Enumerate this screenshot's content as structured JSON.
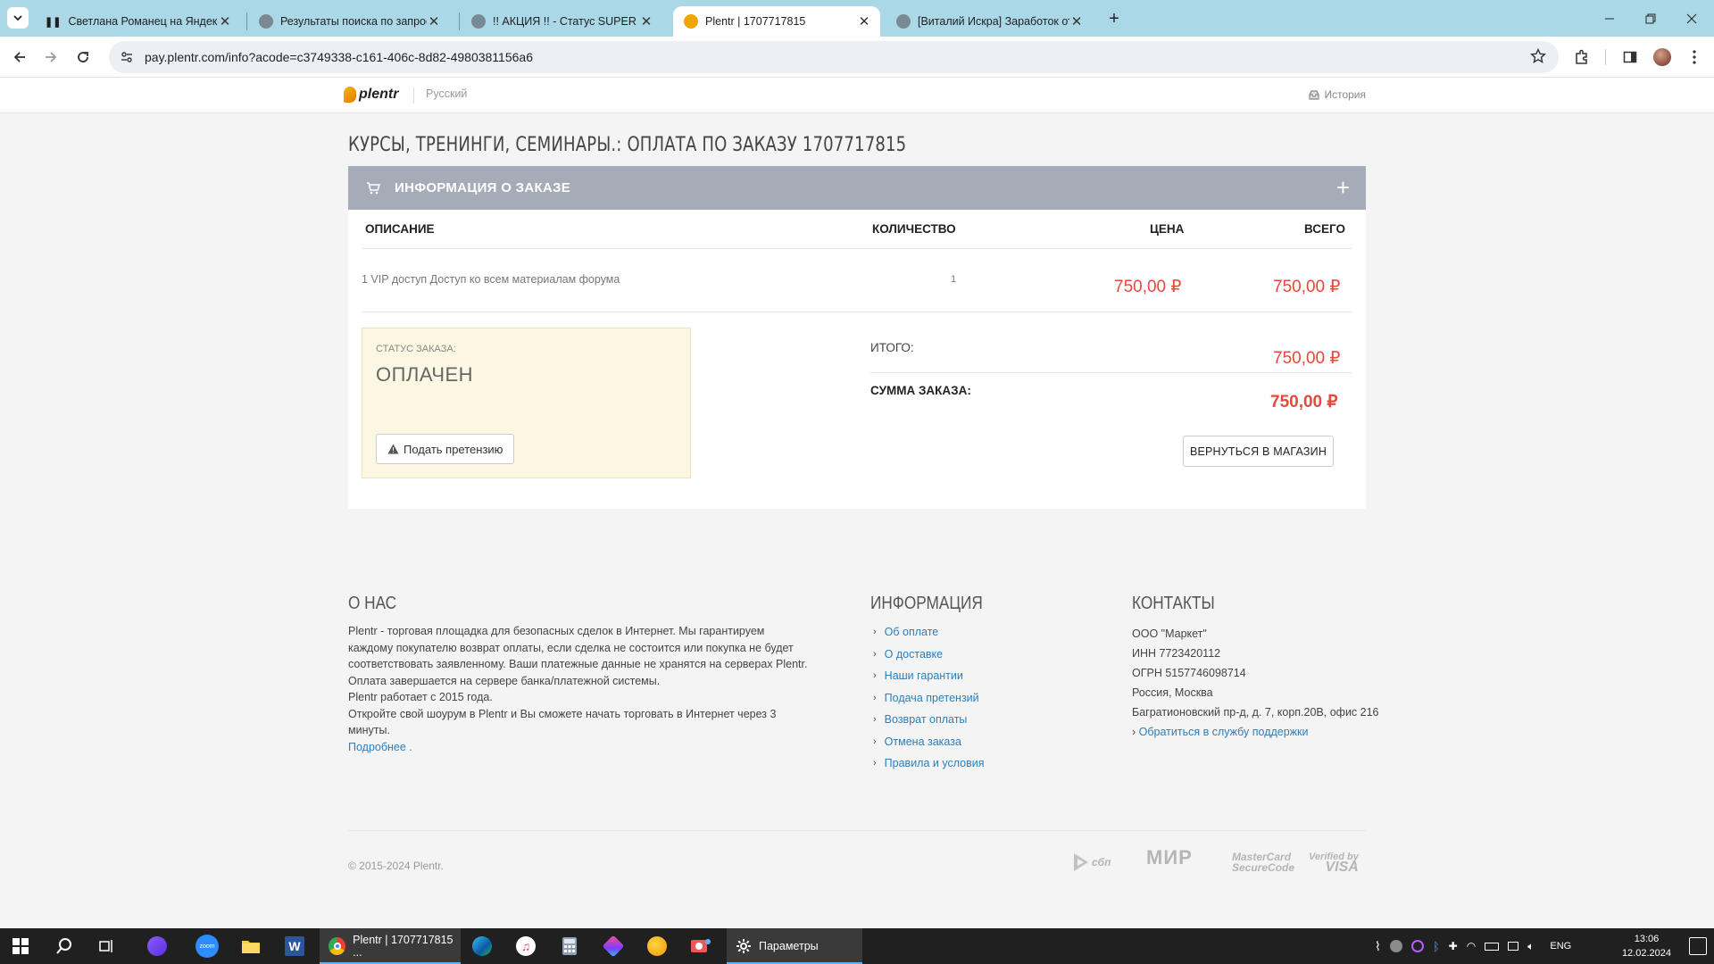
{
  "browser": {
    "tabs": [
      {
        "title": "Светлана Романец на Яндекс",
        "active": false
      },
      {
        "title": "Результаты поиска по запросу",
        "active": false
      },
      {
        "title": "!! АКЦИЯ !! - Статус SUPER VIP",
        "active": false
      },
      {
        "title": "Plentr | 1707717815",
        "active": true
      },
      {
        "title": "[Виталий Искра] Заработок от",
        "active": false
      }
    ],
    "url": "pay.plentr.com/info?acode=c3749338-c161-406c-8d82-4980381156a6"
  },
  "site": {
    "logo_text": "plentr",
    "language": "Русский",
    "history_label": "История"
  },
  "page": {
    "title": "КУРСЫ, ТРЕНИНГИ, СЕМИНАРЫ.: ОПЛАТА ПО ЗАКАЗУ 1707717815",
    "panel_title": "ИНФОРМАЦИЯ О ЗАКАЗЕ",
    "table": {
      "headers": [
        "ОПИСАНИЕ",
        "КОЛИЧЕСТВО",
        "ЦЕНА",
        "ВСЕГО"
      ],
      "rows": [
        {
          "description": "1 VIP доступ Доступ ко всем материалам форума",
          "quantity": "1",
          "price": "750,00 ₽",
          "total": "750,00 ₽"
        }
      ]
    },
    "status": {
      "label": "СТАТУС ЗАКАЗА:",
      "value": "ОПЛАЧЕН",
      "claim_button": "Подать претензию"
    },
    "summary": {
      "subtotal_label": "ИТОГО:",
      "subtotal": "750,00 ₽",
      "total_label": "СУММА ЗАКАЗА:",
      "total": "750,00 ₽"
    },
    "back_button": "ВЕРНУТЬСЯ В МАГАЗИН"
  },
  "footer": {
    "about_title": "О НАС",
    "about_text": "Plentr - торговая площадка для безопасных сделок в Интернет. Мы гарантируем каждому покупателю возврат оплаты, если сделка не состоится или покупка не будет соответствовать заявленному. Ваши платежные данные не хранятся на серверах Plentr. Оплата завершается на сервере банка/платежной системы.",
    "about_since": "Plentr работает с 2015 года.",
    "about_cta": "Откройте свой шоурум в Plentr и Вы сможете начать торговать в Интернет через 3 минуты.",
    "about_more": "Подробнее .",
    "info_title": "ИНФОРМАЦИЯ",
    "info_links": [
      "Об оплате",
      "О доставке",
      "Наши гарантии",
      "Подача претензий",
      "Возврат оплаты",
      "Отмена заказа",
      "Правила и условия"
    ],
    "contacts_title": "КОНТАКТЫ",
    "contacts": {
      "company": "ООО \"Маркет\"",
      "inn": "ИНН 7723420112",
      "ogrn": "ОГРН 5157746098714",
      "city": "Россия, Москва",
      "address": "Багратионовский пр-д, д. 7, корп.20В, офис 216",
      "support": "Обратиться в службу поддержки"
    },
    "copyright": "© 2015-2024 Plentr.",
    "payment_logos": {
      "sbp": "сбп",
      "mir": "МИР",
      "mastercard_1": "MasterCard",
      "mastercard_2": "SecureCode",
      "visa_1": "Verified by",
      "visa_2": "VISA"
    }
  },
  "taskbar": {
    "active_app": "Plentr | 1707717815 ...",
    "settings_app": "Параметры",
    "language": "ENG",
    "time": "13:06",
    "date": "12.02.2024",
    "zoom_label": "zoom"
  },
  "colors": {
    "tabstrip": "#abd8e7",
    "panel_header": "#a5acb8",
    "price": "#e8483b",
    "link": "#2a7fbf",
    "status_bg": "#fcf7e3"
  }
}
